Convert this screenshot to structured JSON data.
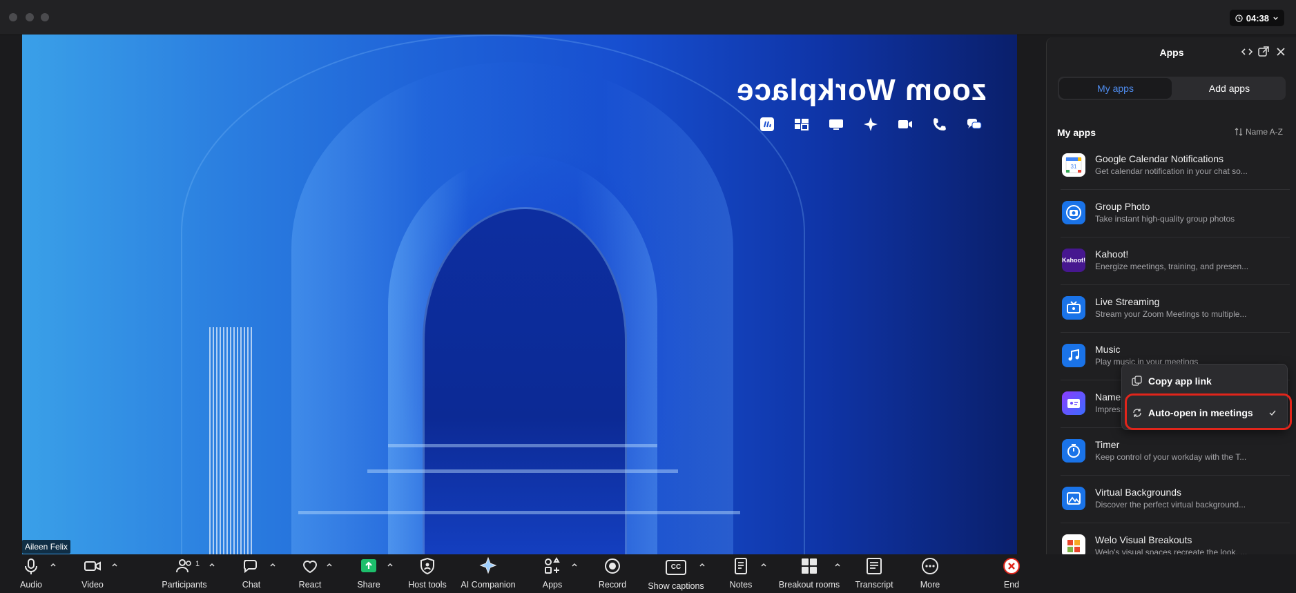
{
  "window": {
    "time": "04:38"
  },
  "video": {
    "participant_name": "Aileen Felix",
    "brand_text": "zoom Workplace"
  },
  "apps_panel": {
    "title": "Apps",
    "tabs": [
      {
        "label": "My apps"
      },
      {
        "label": "Add apps"
      }
    ],
    "section_title": "My apps",
    "sort_label": "Name A-Z",
    "apps": [
      {
        "name": "Google Calendar Notifications",
        "desc": "Get calendar notification in your chat so..."
      },
      {
        "name": "Group Photo",
        "desc": "Take instant high-quality group photos"
      },
      {
        "name": "Kahoot!",
        "desc": "Energize meetings, training, and presen..."
      },
      {
        "name": "Live Streaming",
        "desc": "Stream your Zoom Meetings to multiple..."
      },
      {
        "name": "Music",
        "desc": "Play music in your meetings"
      },
      {
        "name": "Name",
        "desc": "Impress..."
      },
      {
        "name": "Timer",
        "desc": "Keep control of your workday with the T..."
      },
      {
        "name": "Virtual Backgrounds",
        "desc": "Discover the perfect virtual background..."
      },
      {
        "name": "Welo Visual Breakouts",
        "desc": "Welo's visual spaces recreate the look, ..."
      }
    ],
    "kahoot_logo": "Kahoot!"
  },
  "context_menu": {
    "items": [
      {
        "label": "Copy app link"
      },
      {
        "label": "Auto-open in meetings"
      }
    ]
  },
  "toolbar": {
    "audio": "Audio",
    "video": "Video",
    "participants": "Participants",
    "participants_count": "1",
    "chat": "Chat",
    "react": "React",
    "share": "Share",
    "host_tools": "Host tools",
    "ai_companion": "AI Companion",
    "apps": "Apps",
    "record": "Record",
    "show_captions": "Show captions",
    "cc_glyph": "CC",
    "notes": "Notes",
    "breakout_rooms": "Breakout rooms",
    "transcript": "Transcript",
    "more": "More",
    "end": "End"
  },
  "colors": {
    "accent": "#4f8df0",
    "end_red": "#e1251b",
    "share_green": "#1dbe6b",
    "highlight_red": "#e1251b"
  }
}
